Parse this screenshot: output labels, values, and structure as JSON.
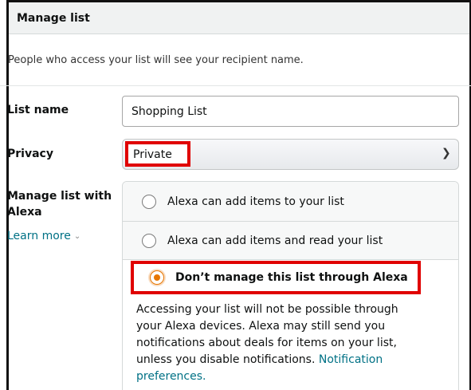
{
  "header": {
    "title": "Manage list"
  },
  "note": "People who access your list will see your recipient name.",
  "list_name": {
    "label": "List name",
    "value": "Shopping List"
  },
  "privacy": {
    "label": "Privacy",
    "selected": "Private"
  },
  "alexa": {
    "label": "Manage list with Alexa",
    "learn_more": "Learn more",
    "options": [
      {
        "label": "Alexa can add items to your list",
        "selected": false
      },
      {
        "label": "Alexa can add items and read your list",
        "selected": false
      },
      {
        "label": "Don’t manage this list through Alexa",
        "selected": true
      }
    ],
    "description": "Accessing your list will not be possible through your Alexa devices. Alexa may still send you notifications about deals for items on your list, unless you disable notifications.",
    "description_link": "Notification preferences."
  },
  "colors": {
    "highlight": "#e00000",
    "link": "#007185",
    "radio_selected": "#e77600"
  }
}
